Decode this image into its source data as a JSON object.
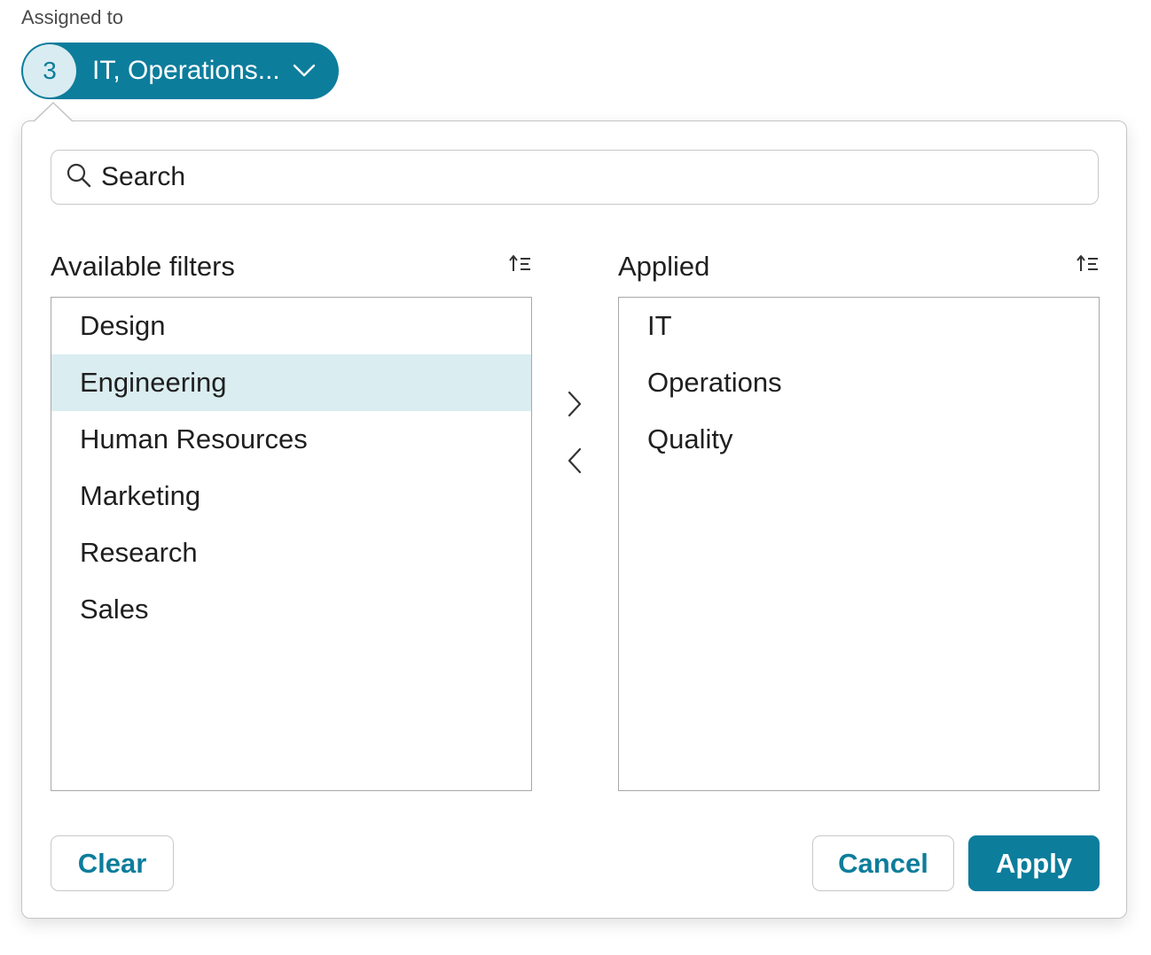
{
  "field": {
    "label": "Assigned to",
    "count": "3",
    "summary": "IT, Operations..."
  },
  "search": {
    "placeholder": "Search",
    "icon": "search-icon"
  },
  "available": {
    "title": "Available filters",
    "sort_icon": "sort-ascending-icon",
    "items": [
      "Design",
      "Engineering",
      "Human Resources",
      "Marketing",
      "Research",
      "Sales"
    ],
    "selected": "Engineering"
  },
  "applied": {
    "title": "Applied",
    "sort_icon": "sort-ascending-icon",
    "items": [
      "IT",
      "Operations",
      "Quality"
    ]
  },
  "actions": {
    "clear": "Clear",
    "cancel": "Cancel",
    "apply": "Apply"
  },
  "colors": {
    "accent": "#0d7d9c",
    "selected_row": "#daedf1",
    "badge_bg": "#d9ecf1"
  }
}
